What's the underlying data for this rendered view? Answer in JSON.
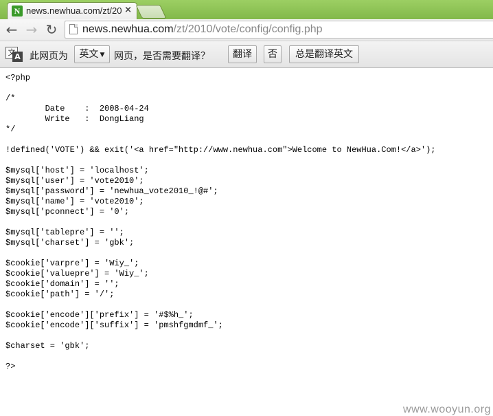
{
  "tab": {
    "favicon_letter": "N",
    "title": "news.newhua.com/zt/20",
    "close": "×"
  },
  "toolbar": {
    "back": "←",
    "forward": "→",
    "reload": "↻",
    "url_host": "news.newhua.com",
    "url_path": "/zt/2010/vote/config/config.php"
  },
  "translate_bar": {
    "icon_a": "文",
    "icon_b": "A",
    "prefix": "此网页为",
    "language": "英文",
    "middle": "网页，是否需要翻译？",
    "translate_button": "翻译",
    "no_button": "否",
    "always_button": "总是翻译英文"
  },
  "content": {
    "lines": [
      "<?php",
      "",
      "/*",
      "        Date    :  2008-04-24",
      "        Write   :  DongLiang",
      "*/",
      "",
      "!defined('VOTE') && exit('<a href=\"http://www.newhua.com\">Welcome to NewHua.Com!</a>');",
      "",
      "$mysql['host'] = 'localhost';",
      "$mysql['user'] = 'vote2010';",
      "$mysql['password'] = 'newhua_vote2010_!@#';",
      "$mysql['name'] = 'vote2010';",
      "$mysql['pconnect'] = '0';",
      "",
      "$mysql['tablepre'] = '';",
      "$mysql['charset'] = 'gbk';",
      "",
      "$cookie['varpre'] = 'Wiy_';",
      "$cookie['valuepre'] = 'Wiy_';",
      "$cookie['domain'] = '';",
      "$cookie['path'] = '/';",
      "",
      "$cookie['encode']['prefix'] = '#$%h_';",
      "$cookie['encode']['suffix'] = 'pmshfgmdmf_';",
      "",
      "$charset = 'gbk';",
      "",
      "?>"
    ]
  },
  "watermark": "www.wooyun.org"
}
